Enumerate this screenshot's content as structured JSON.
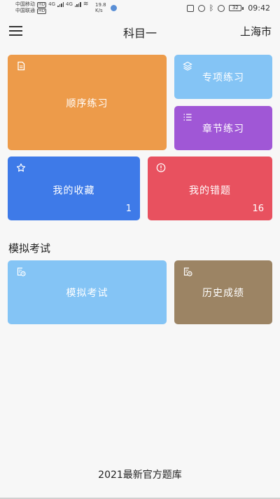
{
  "status_bar": {
    "carrier_1": "中国移动",
    "carrier_2": "中国联通",
    "hd_1": "HD",
    "hd_2": "HD",
    "net_1": "4G",
    "net_2": "4G",
    "speed_value": "19.8",
    "speed_unit": "K/s",
    "battery": "32",
    "time": "09:42"
  },
  "navbar": {
    "title": "科目一",
    "city": "上海市",
    "menu_icon": "hamburger-menu-icon"
  },
  "tiles": {
    "sequential": {
      "label": "顺序练习",
      "icon": "document-icon",
      "color": "#ed9b4a"
    },
    "special": {
      "label": "专项练习",
      "icon": "layers-icon",
      "color": "#84c4f5"
    },
    "chapter": {
      "label": "章节练习",
      "icon": "list-icon",
      "color": "#a057d6"
    },
    "favorites": {
      "label": "我的收藏",
      "count": "1",
      "icon": "star-icon",
      "color": "#3e7ae8"
    },
    "mistakes": {
      "label": "我的错题",
      "count": "16",
      "icon": "alert-circle-icon",
      "color": "#e8515f"
    }
  },
  "exam_section": {
    "title": "模拟考试",
    "mock_exam": {
      "label": "模拟考试",
      "icon": "exam-clock-icon",
      "color": "#84c4f5"
    },
    "history": {
      "label": "历史成绩",
      "icon": "history-record-icon",
      "color": "#9c8464"
    }
  },
  "footer": {
    "text": "2021最新官方题库"
  }
}
